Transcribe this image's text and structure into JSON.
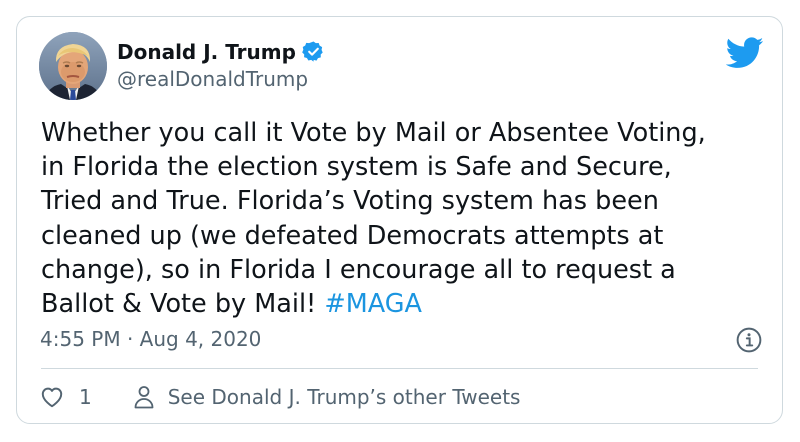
{
  "tweet": {
    "author": {
      "display_name": "Donald J. Trump",
      "handle": "@realDonaldTrump",
      "verified": true,
      "avatar_icon": "profile-photo"
    },
    "text_lines": [
      "Whether you call it Vote by Mail or Absentee Voting,",
      "in Florida the election system is Safe and Secure,",
      "Tried and True. Florida’s Voting system has been",
      "cleaned up (we defeated Democrats attempts at",
      "change), so in Florida I encourage all to request a",
      "Ballot & Vote by Mail! "
    ],
    "hashtag": "#MAGA",
    "timestamp": "4:55 PM · Aug 4, 2020",
    "likes": "1",
    "other_tweets_label": "See Donald J. Trump’s other Tweets"
  },
  "icons": {
    "verified": "verified-badge-icon",
    "logo": "twitter-bird-icon",
    "info": "info-icon",
    "like": "heart-icon",
    "person": "person-icon"
  },
  "colors": {
    "brand_blue": "#1d9bf0",
    "hashtag_blue": "#1b95e0",
    "text": "#0f1419",
    "secondary_text": "#536471",
    "border": "#cfd9de"
  }
}
